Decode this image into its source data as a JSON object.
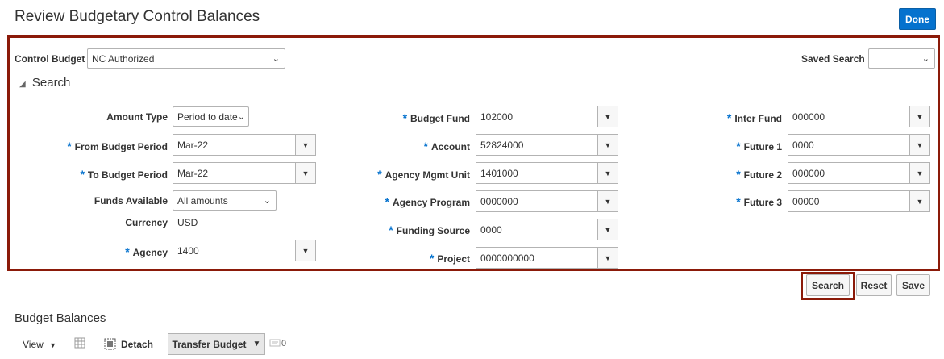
{
  "header": {
    "title": "Review Budgetary Control Balances",
    "done_label": "Done"
  },
  "control_budget": {
    "label": "Control Budget",
    "value": "NC Authorized"
  },
  "saved_search": {
    "label": "Saved Search",
    "value": ""
  },
  "search_section": {
    "title": "Search"
  },
  "required_marker": "*",
  "fields": {
    "amount_type": {
      "label": "Amount Type",
      "value": "Period to date"
    },
    "from_budget_period": {
      "label": "From Budget Period",
      "value": "Mar-22"
    },
    "to_budget_period": {
      "label": "To Budget Period",
      "value": "Mar-22"
    },
    "funds_available": {
      "label": "Funds Available",
      "value": "All amounts"
    },
    "currency": {
      "label": "Currency",
      "value": "USD"
    },
    "agency": {
      "label": "Agency",
      "value": "1400"
    },
    "budget_fund": {
      "label": "Budget Fund",
      "value": "102000"
    },
    "account": {
      "label": "Account",
      "value": "52824000"
    },
    "agency_mgmt_unit": {
      "label": "Agency Mgmt Unit",
      "value": "1401000"
    },
    "agency_program": {
      "label": "Agency Program",
      "value": "0000000"
    },
    "funding_source": {
      "label": "Funding Source",
      "value": "0000"
    },
    "project": {
      "label": "Project",
      "value": "0000000000"
    },
    "inter_fund": {
      "label": "Inter Fund",
      "value": "000000"
    },
    "future_1": {
      "label": "Future 1",
      "value": "0000"
    },
    "future_2": {
      "label": "Future 2",
      "value": "000000"
    },
    "future_3": {
      "label": "Future 3",
      "value": "00000"
    }
  },
  "actions": {
    "search_label": "Search",
    "reset_label": "Reset",
    "save_label": "Save"
  },
  "budget_balances": {
    "title": "Budget Balances",
    "view_label": "View",
    "detach_label": "Detach",
    "transfer_label": "Transfer Budget",
    "count": "0"
  },
  "colors": {
    "accent": "#0572ce",
    "highlight": "#8b1a09"
  },
  "icons": {
    "dropdown": "chevron-down-icon",
    "combo": "caret-down-icon",
    "disclosure": "triangle-expanded-icon",
    "freeze": "freeze-columns-icon",
    "detach": "detach-icon",
    "wrap": "wrap-icon"
  }
}
